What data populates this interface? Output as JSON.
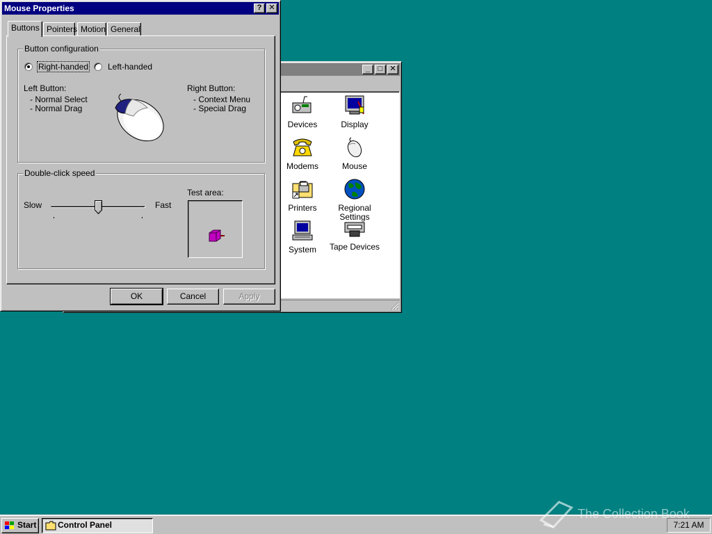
{
  "control_panel": {
    "icons": [
      {
        "label": "Devices",
        "icon": "devices-icon"
      },
      {
        "label": "Display",
        "icon": "display-icon"
      },
      {
        "label": "Modems",
        "icon": "modem-phone-icon"
      },
      {
        "label": "Mouse",
        "icon": "mouse-icon"
      },
      {
        "label": "Printers",
        "icon": "printers-folder-icon"
      },
      {
        "label": "Regional Settings",
        "icon": "globe-icon"
      },
      {
        "label": "System",
        "icon": "computer-icon"
      },
      {
        "label": "Tape Devices",
        "icon": "tape-drive-icon"
      }
    ]
  },
  "dialog": {
    "title": "Mouse Properties",
    "tabs": [
      "Buttons",
      "Pointers",
      "Motion",
      "General"
    ],
    "button_config": {
      "legend": "Button configuration",
      "right_handed": "Right-handed",
      "left_handed": "Left-handed",
      "selected": "Right-handed",
      "left_button_title": "Left Button:",
      "left_button_items": [
        "-  Normal Select",
        "-  Normal Drag"
      ],
      "right_button_title": "Right Button:",
      "right_button_items": [
        "-  Context Menu",
        "-  Special Drag"
      ]
    },
    "double_click": {
      "legend": "Double-click speed",
      "slow": "Slow",
      "fast": "Fast",
      "test_area": "Test area:",
      "slider_level": 0.5
    },
    "buttons": {
      "ok": "OK",
      "cancel": "Cancel",
      "apply": "Apply"
    }
  },
  "taskbar": {
    "start": "Start",
    "task": "Control Panel",
    "clock": "7:21 AM"
  },
  "watermark": "The Collection Book",
  "colors": {
    "desktop": "#008080",
    "titlebar_active": "#000080",
    "face": "#c0c0c0"
  }
}
